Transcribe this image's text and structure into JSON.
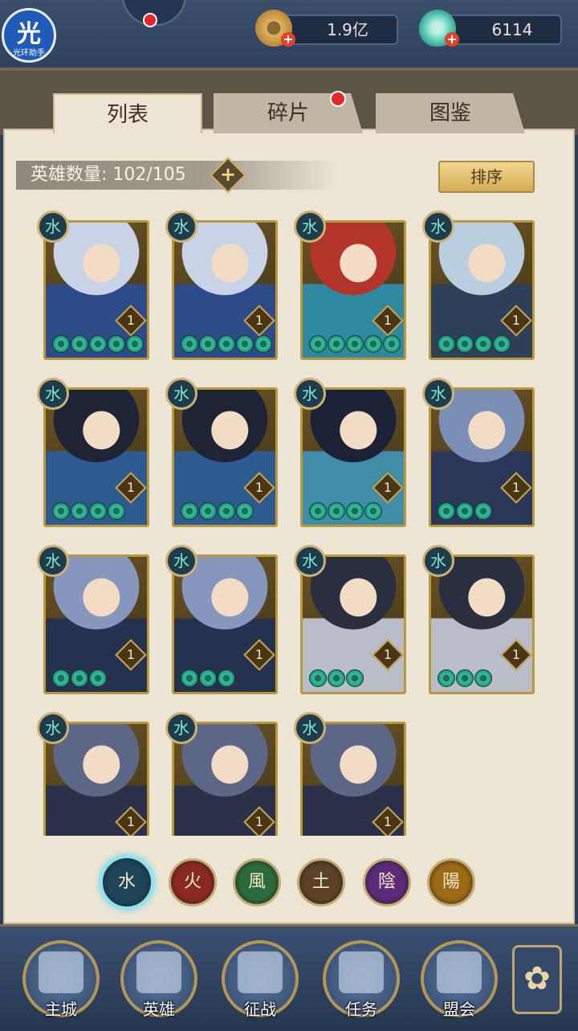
{
  "app": {
    "logo_glyph": "光",
    "logo_text": "光环助手"
  },
  "resources": {
    "coins": "1.9亿",
    "jade": "6114"
  },
  "tabs": [
    {
      "label": "列表",
      "active": true
    },
    {
      "label": "碎片",
      "active": false,
      "notification": true
    },
    {
      "label": "图鉴",
      "active": false
    }
  ],
  "hero_count": {
    "label": "英雄数量: 102/105"
  },
  "sort_button": {
    "label": "排序"
  },
  "heroes": [
    {
      "element": "水",
      "level": "1",
      "stars": 5,
      "palette": [
        "#c9d3e6",
        "#2c4b88"
      ]
    },
    {
      "element": "水",
      "level": "1",
      "stars": 5,
      "palette": [
        "#c9d3e6",
        "#2c4b88"
      ]
    },
    {
      "element": "水",
      "level": "1",
      "stars": 5,
      "palette": [
        "#b3342a",
        "#2f8aa0"
      ]
    },
    {
      "element": "水",
      "level": "1",
      "stars": 4,
      "palette": [
        "#b9cfe0",
        "#2e3f58"
      ]
    },
    {
      "element": "水",
      "level": "1",
      "stars": 4,
      "palette": [
        "#1e2433",
        "#2d5b8f"
      ]
    },
    {
      "element": "水",
      "level": "1",
      "stars": 4,
      "palette": [
        "#1e2433",
        "#2d5b8f"
      ]
    },
    {
      "element": "水",
      "level": "1",
      "stars": 4,
      "palette": [
        "#1b2236",
        "#3f8da6"
      ]
    },
    {
      "element": "水",
      "level": "1",
      "stars": 3,
      "palette": [
        "#7b8fb6",
        "#2a3758"
      ]
    },
    {
      "element": "水",
      "level": "1",
      "stars": 3,
      "palette": [
        "#8796bc",
        "#25324f"
      ]
    },
    {
      "element": "水",
      "level": "1",
      "stars": 3,
      "palette": [
        "#8796bc",
        "#25324f"
      ]
    },
    {
      "element": "水",
      "level": "1",
      "stars": 3,
      "palette": [
        "#2a2f3f",
        "#b9bdc8"
      ]
    },
    {
      "element": "水",
      "level": "1",
      "stars": 3,
      "palette": [
        "#2a2f3f",
        "#b9bdc8"
      ]
    },
    {
      "element": "水",
      "level": "1",
      "stars": 0,
      "palette": [
        "#5b6785",
        "#2a3149"
      ]
    },
    {
      "element": "水",
      "level": "1",
      "stars": 0,
      "palette": [
        "#5b6785",
        "#2a3149"
      ]
    },
    {
      "element": "水",
      "level": "1",
      "stars": 0,
      "palette": [
        "#5b6785",
        "#2a3149"
      ]
    }
  ],
  "elements": [
    {
      "glyph": "水",
      "color": "#1d4457",
      "selected": true
    },
    {
      "glyph": "火",
      "color": "#8a2a1f",
      "selected": false
    },
    {
      "glyph": "風",
      "color": "#2b6a3a",
      "selected": false
    },
    {
      "glyph": "土",
      "color": "#5a4128",
      "selected": false
    },
    {
      "glyph": "陰",
      "color": "#5b2a78",
      "selected": false
    },
    {
      "glyph": "陽",
      "color": "#9a6a14",
      "selected": false
    }
  ],
  "bottom_nav": [
    {
      "label": "主城"
    },
    {
      "label": "英雄"
    },
    {
      "label": "征战"
    },
    {
      "label": "任务"
    },
    {
      "label": "盟会"
    }
  ]
}
